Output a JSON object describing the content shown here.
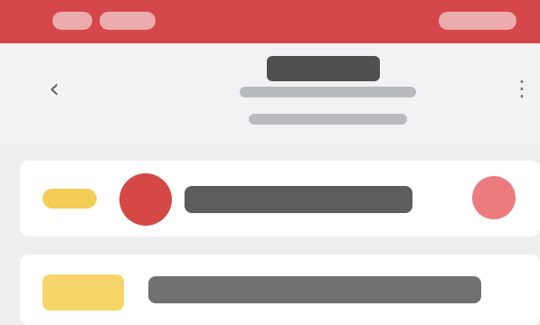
{
  "status_bar": {
    "left_text": "",
    "right_text": ""
  },
  "header": {
    "title": "",
    "subtitle_1": "",
    "subtitle_2": ""
  },
  "cards": [
    {
      "badge": "",
      "text": ""
    },
    {
      "badge": "",
      "text": ""
    }
  ],
  "colors": {
    "status_bar": "#d4474a",
    "badge_yellow": "#f4cd54",
    "avatar_red": "#d64845",
    "avatar_pink": "#ec7b7f"
  },
  "icons": {
    "back": "chevron-left-icon",
    "share": "share-icon"
  }
}
